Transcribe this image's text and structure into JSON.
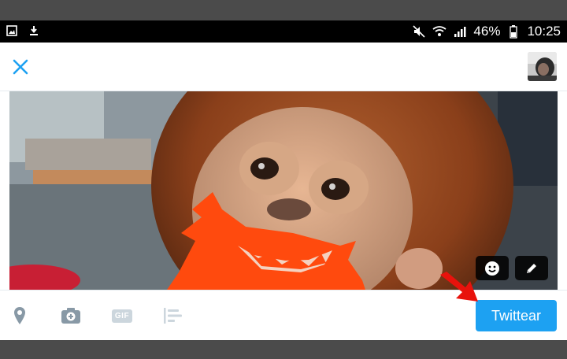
{
  "status_bar": {
    "battery": "46%",
    "time": "10:25",
    "left_icons": [
      "image-icon",
      "download-icon"
    ],
    "right_icons": [
      "mute-icon",
      "wifi-icon",
      "signal-icon",
      "battery-icon"
    ]
  },
  "compose": {
    "close_icon": "close-icon",
    "avatar": "avatar"
  },
  "media": {
    "description_icon": "sticker-icon",
    "edit_icon": "pencil-icon"
  },
  "toolbar": {
    "location_icon": "location-icon",
    "camera_icon": "camera-icon",
    "gif_label": "GIF",
    "poll_icon": "poll-icon",
    "tweet_label": "Twittear"
  },
  "colors": {
    "accent": "#1da1f2",
    "arrow": "#e8120c",
    "beard": "#ff4a0e"
  }
}
